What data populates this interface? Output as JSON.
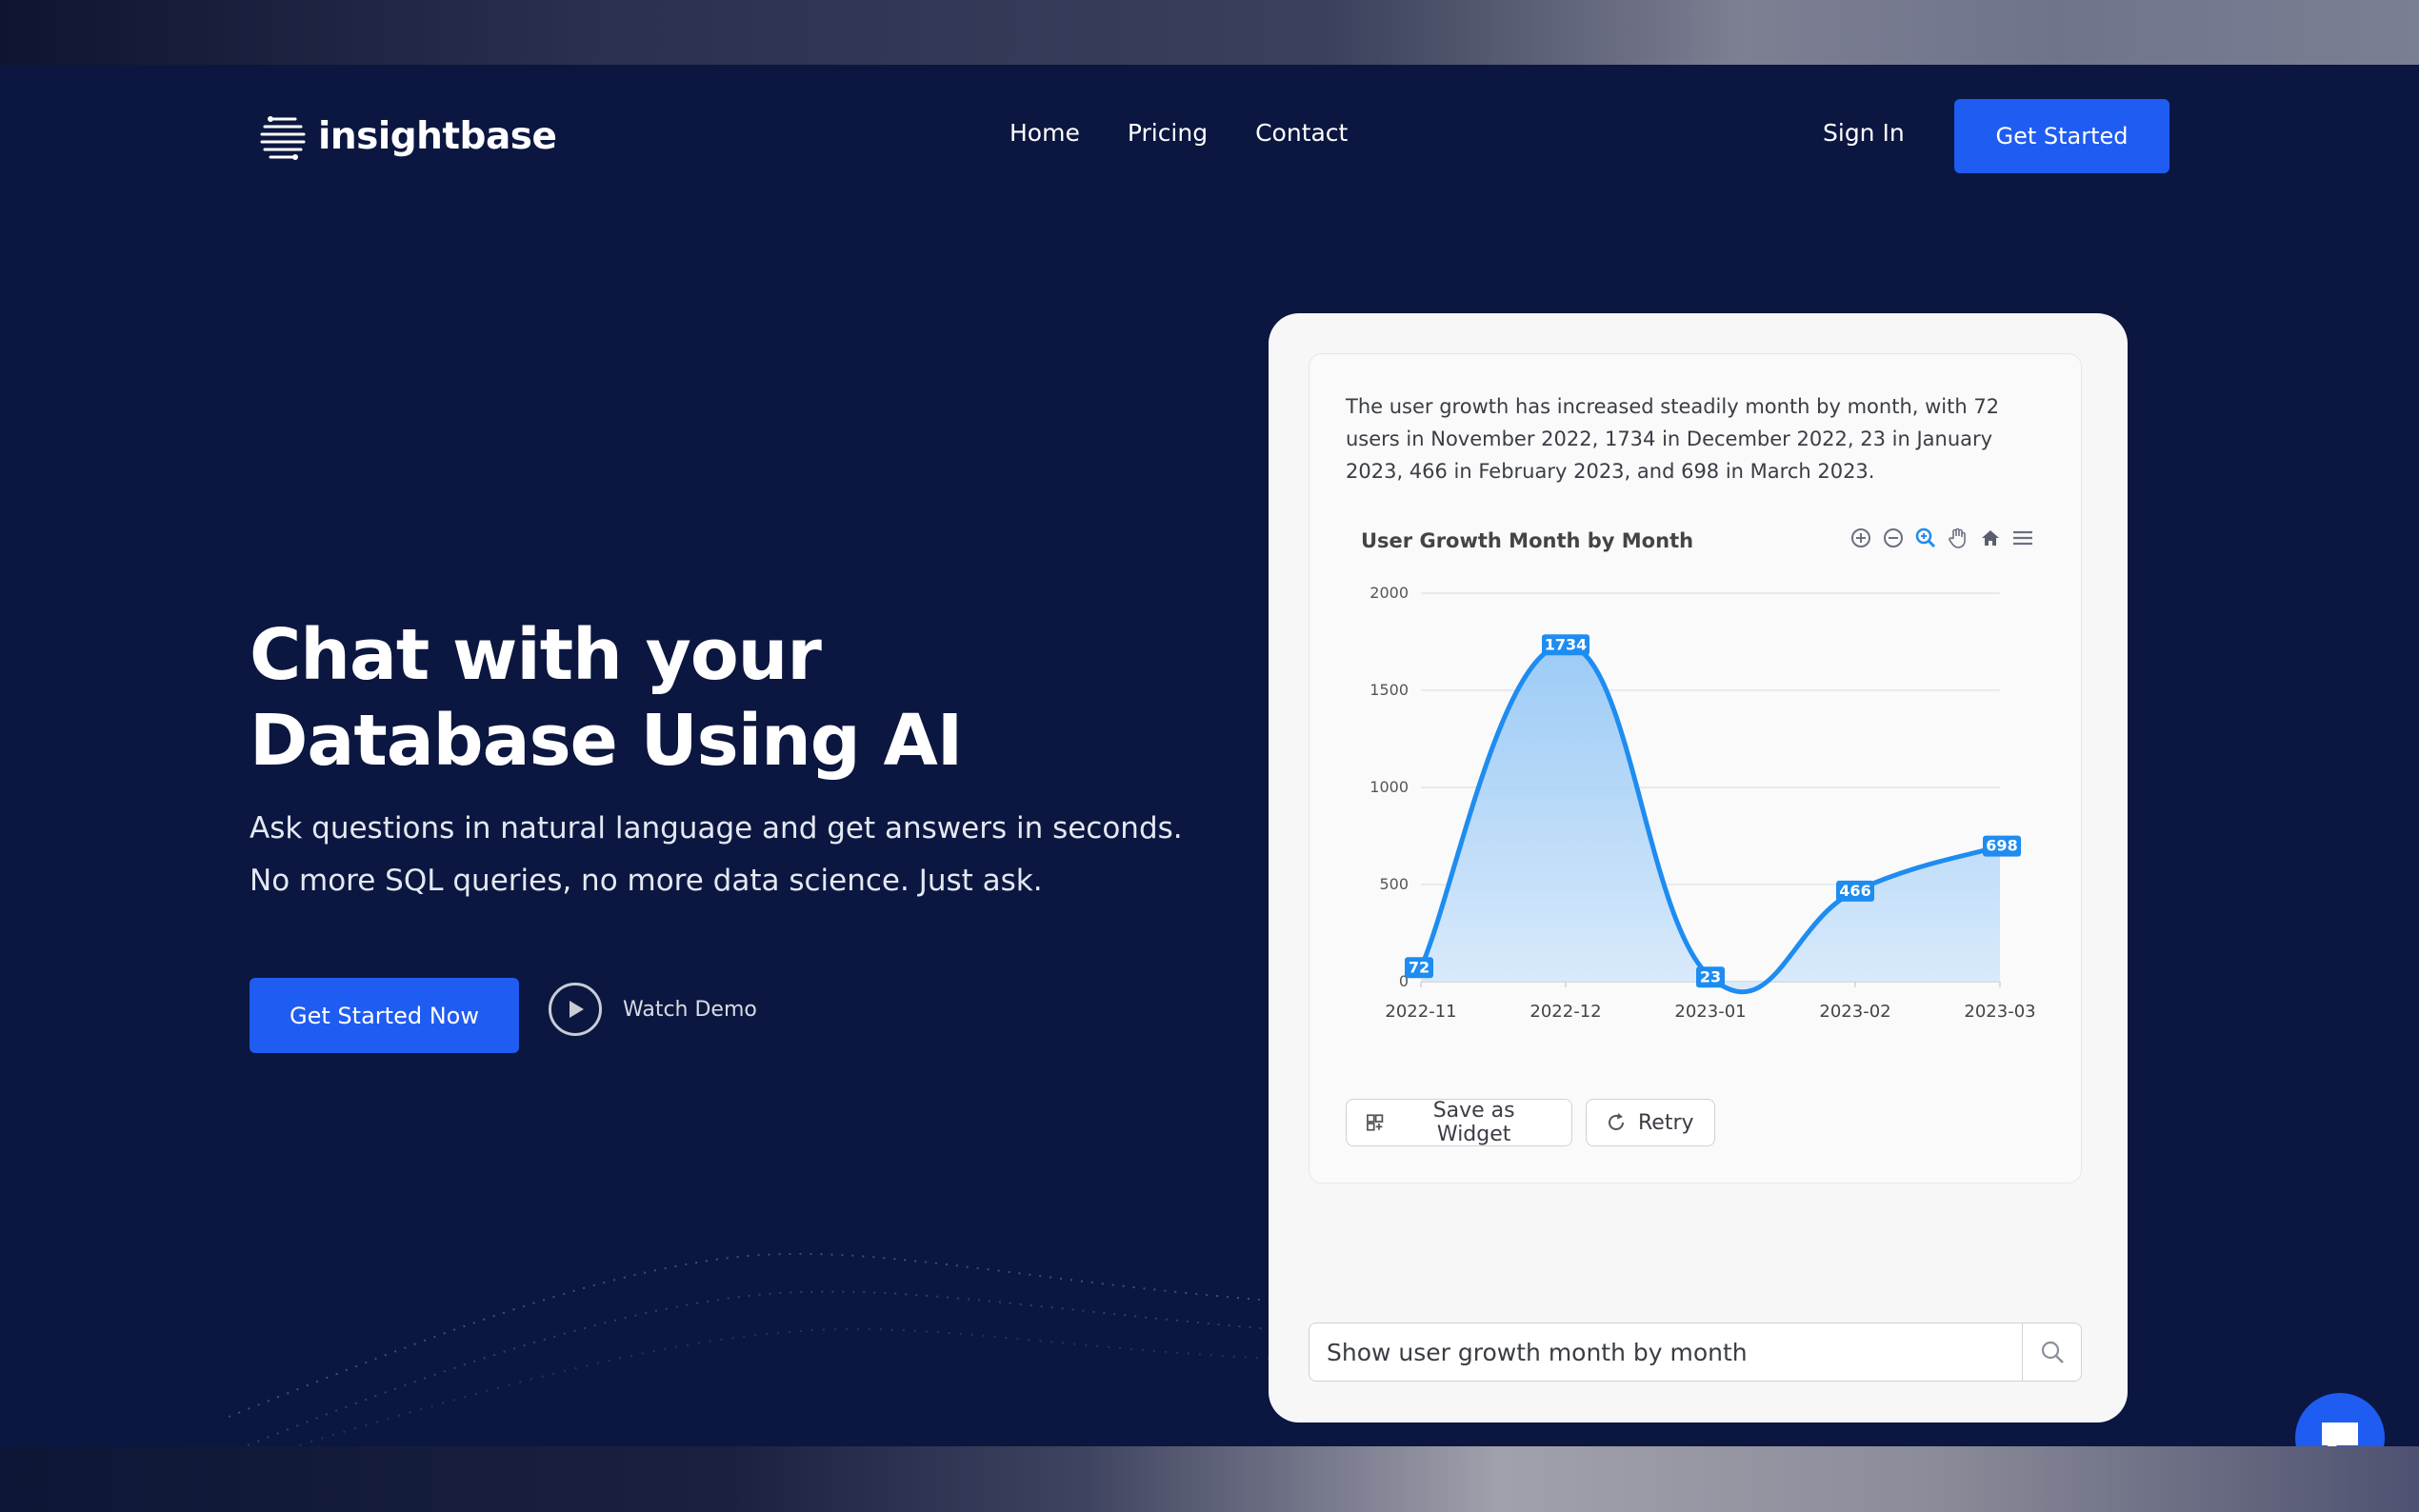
{
  "brand": {
    "name": "insightbase"
  },
  "nav": {
    "links": [
      "Home",
      "Pricing",
      "Contact"
    ],
    "sign_in": "Sign In",
    "cta": "Get Started"
  },
  "hero": {
    "title": "Chat with your Database Using AI",
    "subtitle": "Ask questions in natural language and get answers in seconds. No more SQL queries, no more data science. Just ask.",
    "primary_cta": "Get Started Now",
    "secondary_cta": "Watch Demo"
  },
  "card": {
    "summary": "The user growth has increased steadily month by month, with 72 users in November 2022, 1734 in December 2022, 23 in January 2023, 466 in February 2023, and 698 in March 2023.",
    "save_widget_label": "Save as Widget",
    "retry_label": "Retry",
    "query_value": "Show user growth month by month",
    "toolbar_icons": [
      "zoom-in-icon",
      "zoom-out-icon",
      "zoom-search-icon",
      "pan-hand-icon",
      "home-icon",
      "menu-icon"
    ]
  },
  "colors": {
    "accent": "#1f5cf2",
    "background": "#0b1740",
    "series": "#1e8cf0"
  },
  "chart_data": {
    "type": "area",
    "title": "User Growth Month by Month",
    "categories": [
      "2022-11",
      "2022-12",
      "2023-01",
      "2023-02",
      "2023-03"
    ],
    "values": [
      72,
      1734,
      23,
      466,
      698
    ],
    "ylim": [
      0,
      2000
    ],
    "yticks": [
      0,
      500,
      1000,
      1500,
      2000
    ],
    "grid": true,
    "data_labels": true
  }
}
